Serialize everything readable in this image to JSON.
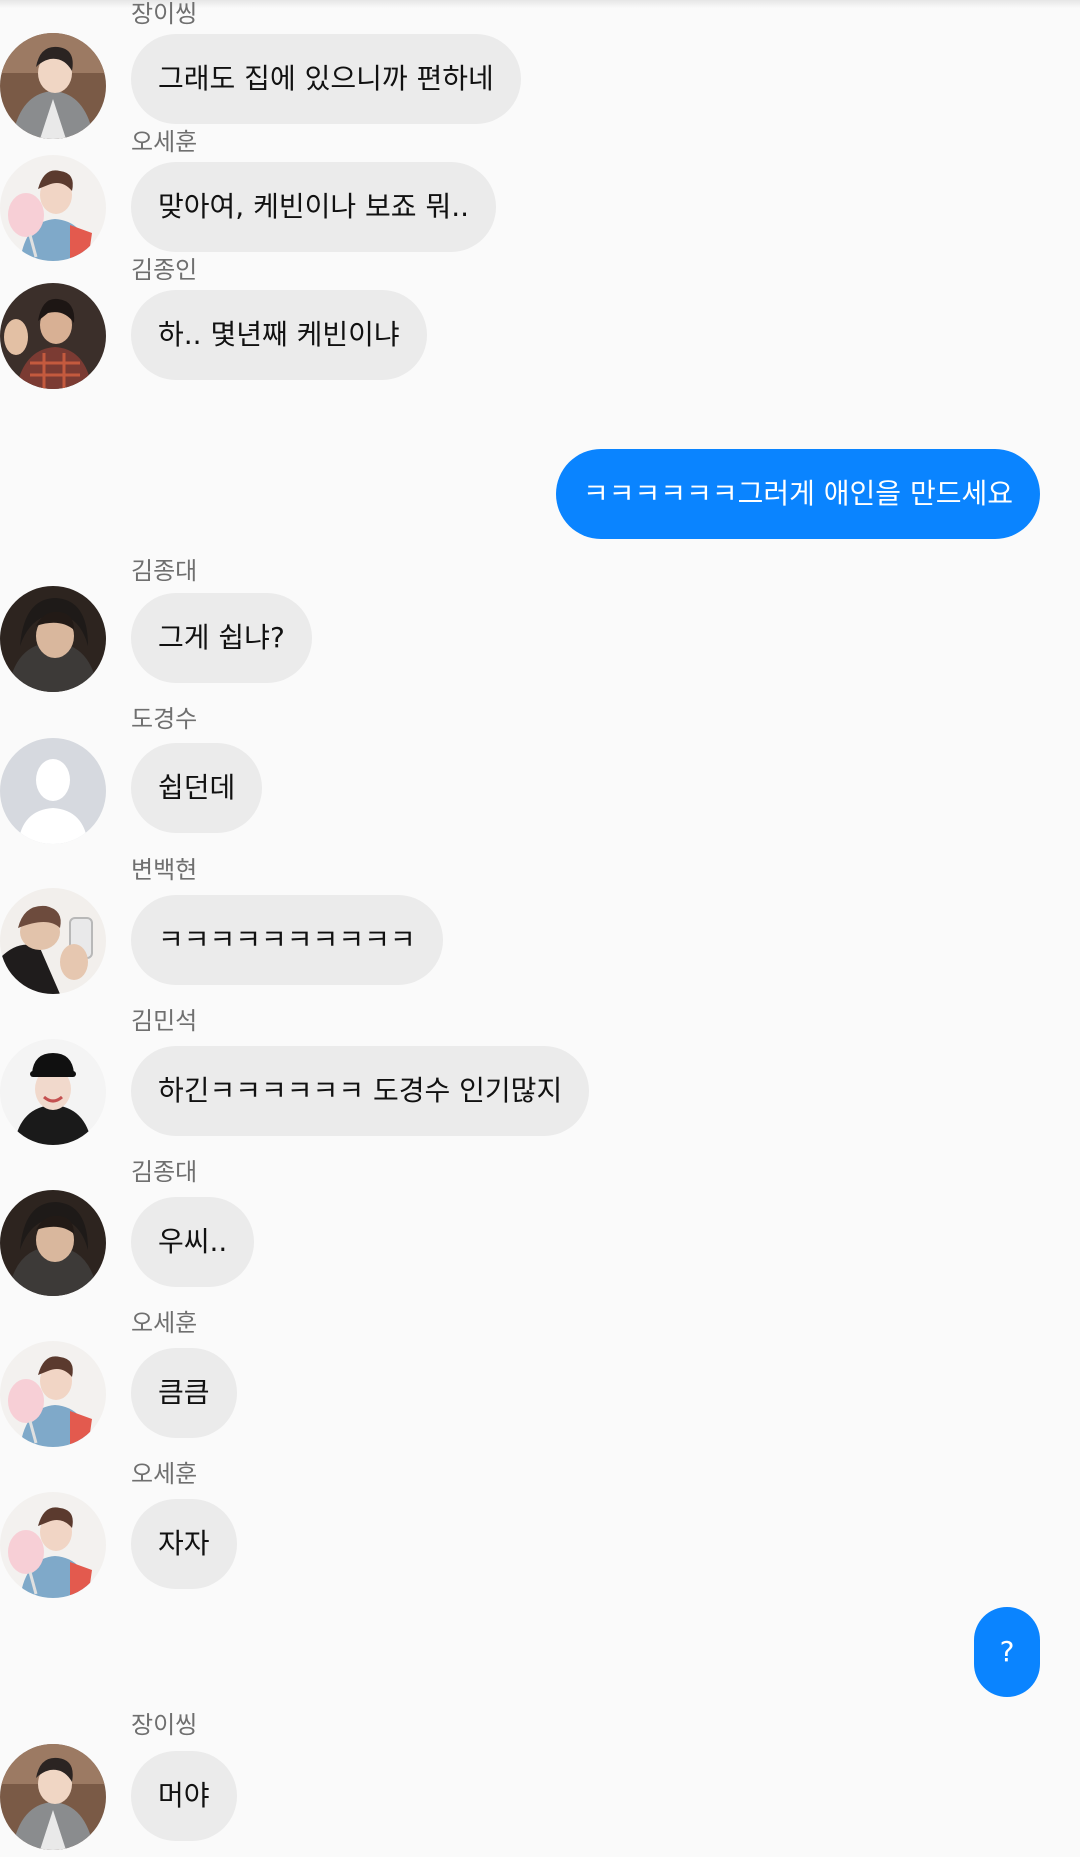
{
  "colors": {
    "background": "#fafafa",
    "incoming_bubble": "#ebebeb",
    "outgoing_bubble": "#0a84ff",
    "sender_name": "#6f6f6f"
  },
  "messages": [
    {
      "sender": "장이씽",
      "text": "그래도 집에 있으니까 편하네",
      "avatar": "avatar-zhang"
    },
    {
      "sender": "오세훈",
      "text": "맞아여, 케빈이나 보죠 뭐..",
      "avatar": "avatar-oh"
    },
    {
      "sender": "김종인",
      "text": "하.. 몇년째 케빈이냐",
      "avatar": "avatar-kimjongin"
    },
    {
      "outgoing": true,
      "text": "ㅋㅋㅋㅋㅋㅋ그러게 애인을 만드세요"
    },
    {
      "sender": "김종대",
      "text": "그게 쉽냐?",
      "avatar": "avatar-kimjongdae"
    },
    {
      "sender": "도경수",
      "text": "쉽던데",
      "avatar": "default-avatar-icon"
    },
    {
      "sender": "변백현",
      "text": "ㅋㅋㅋㅋㅋㅋㅋㅋㅋㅋ",
      "avatar": "avatar-byun"
    },
    {
      "sender": "김민석",
      "text": "하긴ㅋㅋㅋㅋㅋㅋ 도경수 인기많지",
      "avatar": "avatar-kimminseok"
    },
    {
      "sender": "김종대",
      "text": "우씨..",
      "avatar": "avatar-kimjongdae"
    },
    {
      "sender": "오세훈",
      "text": "큼큼",
      "avatar": "avatar-oh"
    },
    {
      "sender": "오세훈",
      "text": "자자",
      "avatar": "avatar-oh"
    },
    {
      "outgoing": true,
      "text": "?"
    },
    {
      "sender": "장이씽",
      "text": "머야",
      "avatar": "avatar-zhang"
    }
  ]
}
